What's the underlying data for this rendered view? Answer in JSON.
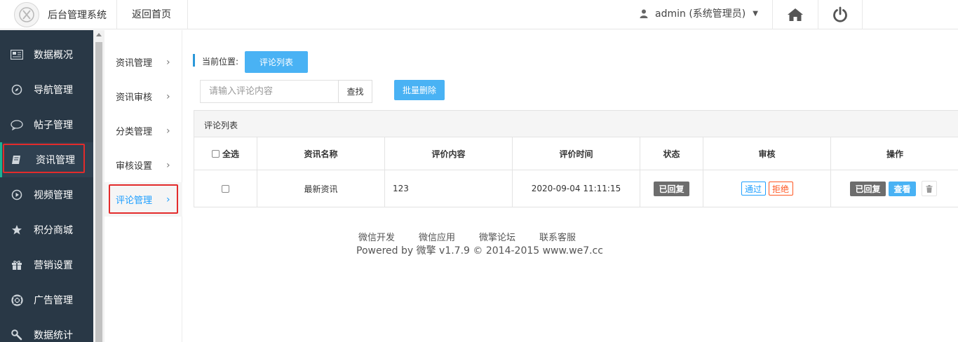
{
  "header": {
    "brand": "后台管理系统",
    "home_link": "返回首页",
    "user": "admin (系统管理员)"
  },
  "sidebar": {
    "items": [
      {
        "label": "数据概况",
        "icon": "newspaper-icon"
      },
      {
        "label": "导航管理",
        "icon": "compass-icon"
      },
      {
        "label": "帖子管理",
        "icon": "comment-icon"
      },
      {
        "label": "资讯管理",
        "icon": "book-icon",
        "active": true
      },
      {
        "label": "视频管理",
        "icon": "play-circle-icon"
      },
      {
        "label": "积分商城",
        "icon": "star-icon"
      },
      {
        "label": "营销设置",
        "icon": "gift-icon"
      },
      {
        "label": "广告管理",
        "icon": "lifebuoy-icon"
      },
      {
        "label": "数据统计",
        "icon": "wrench-icon"
      }
    ]
  },
  "submenu": {
    "items": [
      {
        "label": "资讯管理"
      },
      {
        "label": "资讯审核"
      },
      {
        "label": "分类管理"
      },
      {
        "label": "审核设置"
      },
      {
        "label": "评论管理",
        "active": true
      }
    ],
    "chevron": "›"
  },
  "main": {
    "crumb_label": "当前位置:",
    "crumb_current": "评论列表",
    "search_placeholder": "请输入评论内容",
    "search_button": "查找",
    "batch_delete": "批量删除",
    "panel_title": "评论列表",
    "table": {
      "headers": {
        "select_all": "全选",
        "name": "资讯名称",
        "content": "评价内容",
        "time": "评价时间",
        "status": "状态",
        "review": "审核",
        "actions": "操作"
      },
      "rows": [
        {
          "name": "最新资讯",
          "content": "123",
          "time": "2020-09-04 11:11:15",
          "status": "已回复",
          "approve": "通过",
          "reject": "拒绝",
          "replied": "已回复",
          "view": "查看"
        }
      ]
    }
  },
  "footer": {
    "links": [
      "微信开发",
      "微信应用",
      "微擎论坛",
      "联系客服"
    ],
    "powered": "Powered by 微擎 v1.7.9 © 2014-2015 www.we7.cc"
  },
  "colors": {
    "sidebar_bg": "#293846",
    "accent_blue": "#49b2f4",
    "highlight_red": "#e32b2b",
    "approve_blue": "#1e9fff",
    "reject_orange": "#ff5722"
  }
}
